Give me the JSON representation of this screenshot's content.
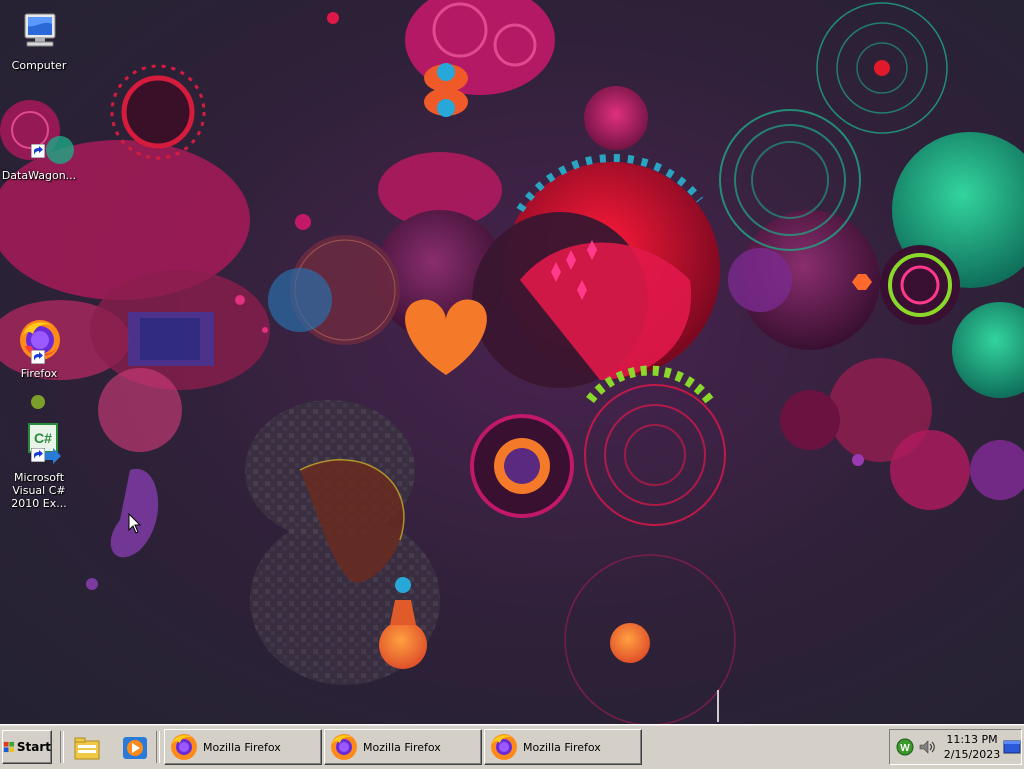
{
  "desktop": {
    "icons": [
      {
        "label": "Computer",
        "icon": "computer-icon"
      },
      {
        "label": "DataWagon...",
        "icon": "datawagon-shortcut-icon"
      },
      {
        "label": "Firefox",
        "icon": "firefox-icon"
      },
      {
        "label": "Microsoft Visual C# 2010 Ex...",
        "icon": "visual-csharp-icon"
      }
    ]
  },
  "taskbar": {
    "start_label": "Start",
    "quick_launch": [
      {
        "icon": "windows-explorer-icon"
      },
      {
        "icon": "media-player-icon"
      }
    ],
    "tasks": [
      {
        "label": "Mozilla Firefox",
        "icon": "firefox-icon"
      },
      {
        "label": "Mozilla Firefox",
        "icon": "firefox-icon"
      },
      {
        "label": "Mozilla Firefox",
        "icon": "firefox-icon"
      }
    ],
    "tray": {
      "icons": [
        "network-w-icon",
        "volume-icon",
        "show-desktop-icon"
      ],
      "time": "11:13 PM",
      "date": "2/15/2023"
    }
  },
  "colors": {
    "taskbar_bg": "#d4d0c8",
    "desktop_bg": "#2e2138",
    "accent_magenta": "#c2186a",
    "accent_teal": "#1fa886",
    "accent_orange": "#f47a2a"
  }
}
